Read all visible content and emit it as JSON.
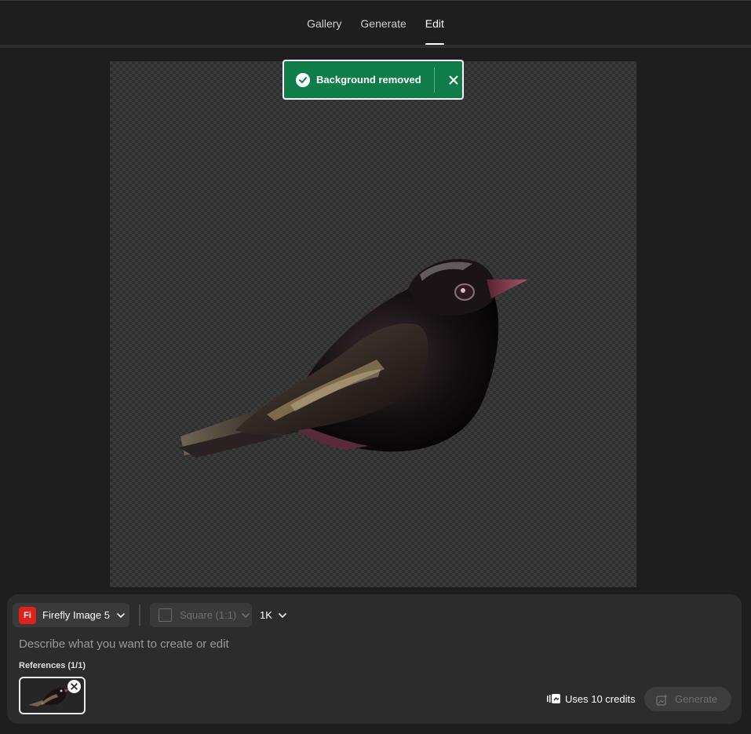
{
  "nav": {
    "tabs": [
      {
        "label": "Gallery",
        "active": false
      },
      {
        "label": "Generate",
        "active": false
      },
      {
        "label": "Edit",
        "active": true
      }
    ]
  },
  "toast": {
    "message": "Background removed",
    "color": "#0f7d4a"
  },
  "canvas": {
    "content": "glossy black bird with transparent background"
  },
  "panel": {
    "model": {
      "label": "Firefly Image 5",
      "logo_text": "Fi",
      "logo_color": "#e0211b"
    },
    "aspect_ratio": {
      "label": "Square (1:1)",
      "disabled": true
    },
    "resolution": {
      "label": "1K"
    },
    "prompt": {
      "placeholder": "Describe what you want to create or edit",
      "value": ""
    },
    "references": {
      "label": "References (1/1)"
    },
    "credits": {
      "label": "Uses 10 credits"
    },
    "generate": {
      "label": "Generate",
      "disabled": true
    }
  }
}
